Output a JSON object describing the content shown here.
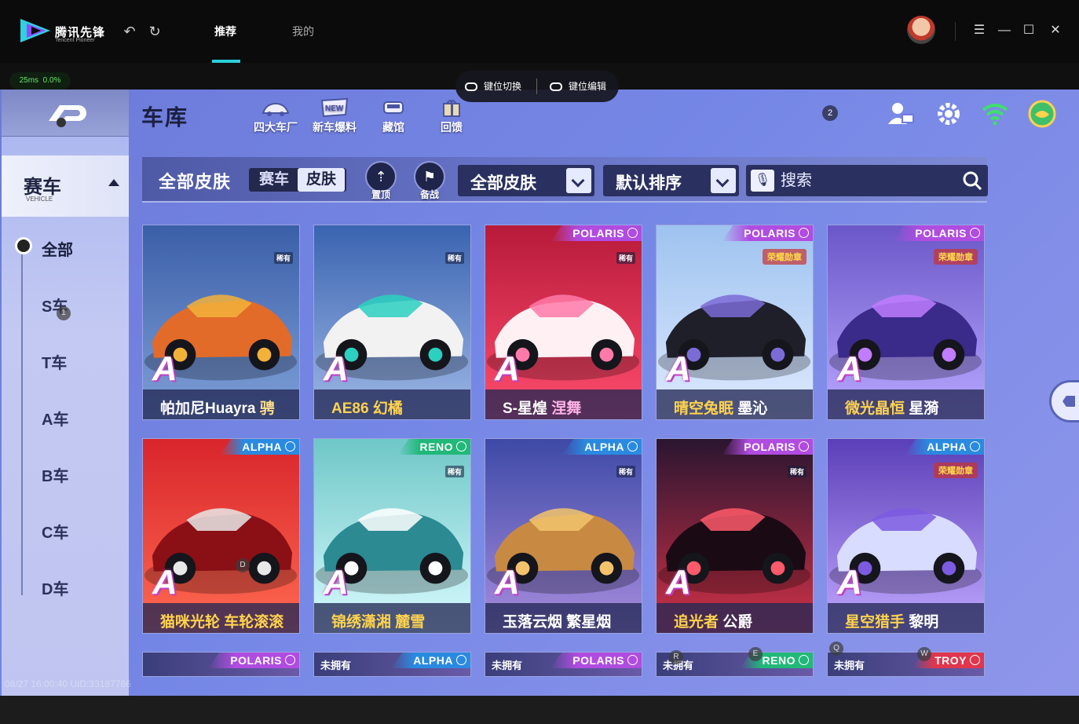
{
  "launcher": {
    "logo_text": "腾讯先锋",
    "logo_sub": "Tencent Pioneer",
    "tabs": [
      "推荐",
      "我的"
    ],
    "latency": "25ms",
    "loss": "0.0%"
  },
  "keybind": {
    "switch_label": "键位切换",
    "edit_label": "键位编辑"
  },
  "game": {
    "title": "车库",
    "notification_count": "2",
    "tools": [
      "四大车厂",
      "新车爆料",
      "藏馆",
      "回馈"
    ],
    "sidebar": {
      "section_title": "赛车",
      "section_sub": "VEHICLE",
      "items": [
        "全部",
        "S车",
        "T车",
        "A车",
        "B车",
        "C车",
        "D车"
      ]
    },
    "filter": {
      "label": "全部皮肤",
      "segment": [
        "赛车",
        "皮肤"
      ],
      "pin_label": "置顶",
      "backup_label": "备战",
      "skin_dropdown": "全部皮肤",
      "sort_dropdown": "默认排序",
      "search_placeholder": "搜索"
    },
    "cards": [
      {
        "name": "帕加尼Huayra",
        "skin": "骋",
        "rank": "A",
        "series": "",
        "owned": "稀有",
        "name_color": "#ffffff",
        "skin_color": "#ffe08a",
        "art": "pagani"
      },
      {
        "name": "AE86",
        "skin": "幻橘",
        "rank": "A",
        "series": "",
        "owned": "稀有",
        "name_color": "#ffd34d",
        "skin_color": "#ffd34d",
        "art": "ae86"
      },
      {
        "name": "S-星煌",
        "skin": "涅舞",
        "rank": "A",
        "series": "POLARIS",
        "owned": "稀有",
        "name_color": "#ffffff",
        "skin_color": "#ffb3e6",
        "art": "xinghuang"
      },
      {
        "name": "晴空兔眠",
        "skin": "墨沁",
        "rank": "A",
        "series": "POLARIS",
        "owned": "",
        "medal": "荣耀勋章",
        "name_color": "#ffd34d",
        "skin_color": "#ffffff",
        "art": "qingkong"
      },
      {
        "name": "微光晶恒",
        "skin": "星漪",
        "rank": "A",
        "series": "POLARIS",
        "owned": "",
        "medal": "荣耀勋章",
        "name_color": "#ffd34d",
        "skin_color": "#ffffff",
        "art": "weiguang"
      },
      {
        "name": "猫咪光轮",
        "skin": "车轮滚滚",
        "rank": "A",
        "series": "ALPHA",
        "owned": "",
        "name_color": "#ffd34d",
        "skin_color": "#ffd34d",
        "art": "maomi"
      },
      {
        "name": "锦绣潇湘",
        "skin": "麓雪",
        "rank": "A",
        "series": "RENO",
        "owned": "稀有",
        "name_color": "#ffd34d",
        "skin_color": "#ffd34d",
        "art": "jinxiu"
      },
      {
        "name": "玉落云烟",
        "skin": "繁星烟",
        "rank": "A",
        "series": "ALPHA",
        "owned": "稀有",
        "name_color": "#ffffff",
        "skin_color": "#ffffff",
        "art": "yuluo"
      },
      {
        "name": "追光者",
        "skin": "公爵",
        "rank": "A",
        "series": "POLARIS",
        "owned": "稀有",
        "name_color": "#ffd34d",
        "skin_color": "#ffffff",
        "art": "zhuiguang"
      },
      {
        "name": "星空猎手",
        "skin": "黎明",
        "rank": "A",
        "series": "ALPHA",
        "owned": "",
        "medal": "荣耀勋章",
        "name_color": "#ffd34d",
        "skin_color": "#ffffff",
        "art": "xingkong"
      }
    ],
    "partial_cards": [
      {
        "series": "POLARIS",
        "unowned": ""
      },
      {
        "series": "ALPHA",
        "unowned": "未拥有"
      },
      {
        "series": "POLARIS",
        "unowned": "未拥有"
      },
      {
        "series": "RENO",
        "unowned": "未拥有"
      },
      {
        "series": "TROY",
        "unowned": "未拥有"
      }
    ],
    "uid_line": "08/27 16:00:40 UID:33187766",
    "key_hints": [
      "1",
      "D",
      "R",
      "E",
      "Q",
      "W"
    ]
  }
}
